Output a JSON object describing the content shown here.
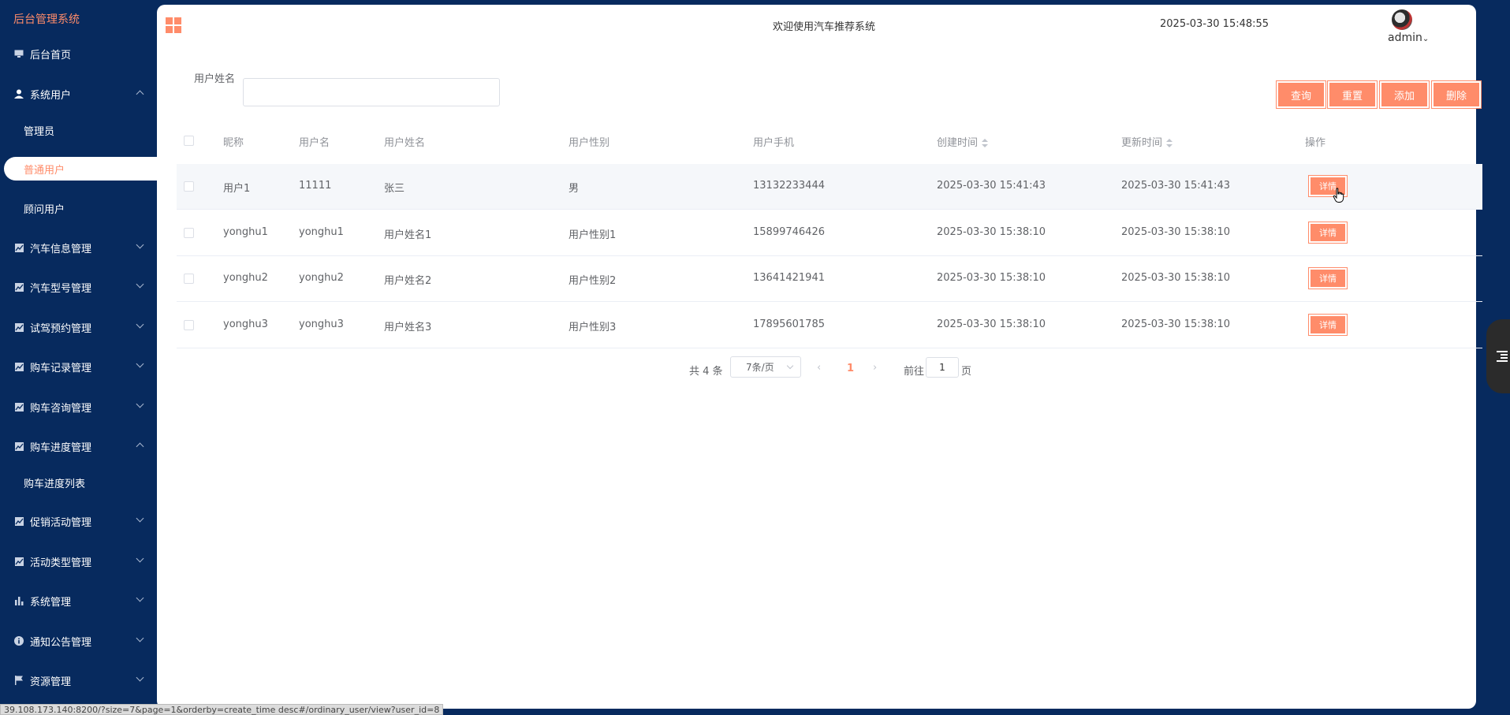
{
  "app_title": "后台管理系统",
  "sidebar": {
    "items": [
      {
        "label": "后台首页",
        "icon": "monitor-icon"
      },
      {
        "label": "系统用户",
        "icon": "user-icon",
        "expanded": true
      },
      {
        "label": "管理员"
      },
      {
        "label": "普通用户",
        "active": true
      },
      {
        "label": "顾问用户"
      },
      {
        "label": "汽车信息管理",
        "icon": "chart-icon"
      },
      {
        "label": "汽车型号管理",
        "icon": "chart-icon"
      },
      {
        "label": "试驾预约管理",
        "icon": "chart-icon"
      },
      {
        "label": "购车记录管理",
        "icon": "chart-icon"
      },
      {
        "label": "购车咨询管理",
        "icon": "chart-icon"
      },
      {
        "label": "购车进度管理",
        "icon": "chart-icon",
        "expanded": true
      },
      {
        "label": "购车进度列表"
      },
      {
        "label": "促销活动管理",
        "icon": "chart-icon"
      },
      {
        "label": "活动类型管理",
        "icon": "chart-icon"
      },
      {
        "label": "系统管理",
        "icon": "bar-chart-icon"
      },
      {
        "label": "通知公告管理",
        "icon": "info-icon"
      },
      {
        "label": "资源管理",
        "icon": "flag-icon"
      }
    ]
  },
  "header": {
    "welcome": "欢迎使用汽车推荐系统",
    "datetime": "2025-03-30 15:48:55",
    "user": "admin"
  },
  "search": {
    "label": "用户姓名",
    "value": "",
    "placeholder": ""
  },
  "toolbar": {
    "query": "查询",
    "reset": "重置",
    "add": "添加",
    "delete": "删除"
  },
  "table": {
    "columns": [
      "昵称",
      "用户名",
      "用户姓名",
      "用户性别",
      "用户手机",
      "创建时间",
      "更新时间",
      "操作"
    ],
    "rows": [
      {
        "nickname": "用户1",
        "username": "11111",
        "name": "张三",
        "gender": "男",
        "phone": "13132233444",
        "created": "2025-03-30 15:41:43",
        "updated": "2025-03-30 15:41:43",
        "action": "详情"
      },
      {
        "nickname": "yonghu1",
        "username": "yonghu1",
        "name": "用户姓名1",
        "gender": "用户性别1",
        "phone": "15899746426",
        "created": "2025-03-30 15:38:10",
        "updated": "2025-03-30 15:38:10",
        "action": "详情"
      },
      {
        "nickname": "yonghu2",
        "username": "yonghu2",
        "name": "用户姓名2",
        "gender": "用户性别2",
        "phone": "13641421941",
        "created": "2025-03-30 15:38:10",
        "updated": "2025-03-30 15:38:10",
        "action": "详情"
      },
      {
        "nickname": "yonghu3",
        "username": "yonghu3",
        "name": "用户姓名3",
        "gender": "用户性别3",
        "phone": "17895601785",
        "created": "2025-03-30 15:38:10",
        "updated": "2025-03-30 15:38:10",
        "action": "详情"
      }
    ]
  },
  "pagination": {
    "total": "共 4 条",
    "page_size": "7条/页",
    "current_page": "1",
    "goto_prefix": "前往",
    "goto_value": "1",
    "goto_suffix": "页"
  },
  "status_url": "39.108.173.140:8200/?size=7&page=1&orderby=create_time desc#/ordinary_user/view?user_id=8",
  "colors": {
    "sidebar_bg": "#072a5e",
    "accent": "#ff8c6a",
    "panel_bg": "#ffffff"
  }
}
